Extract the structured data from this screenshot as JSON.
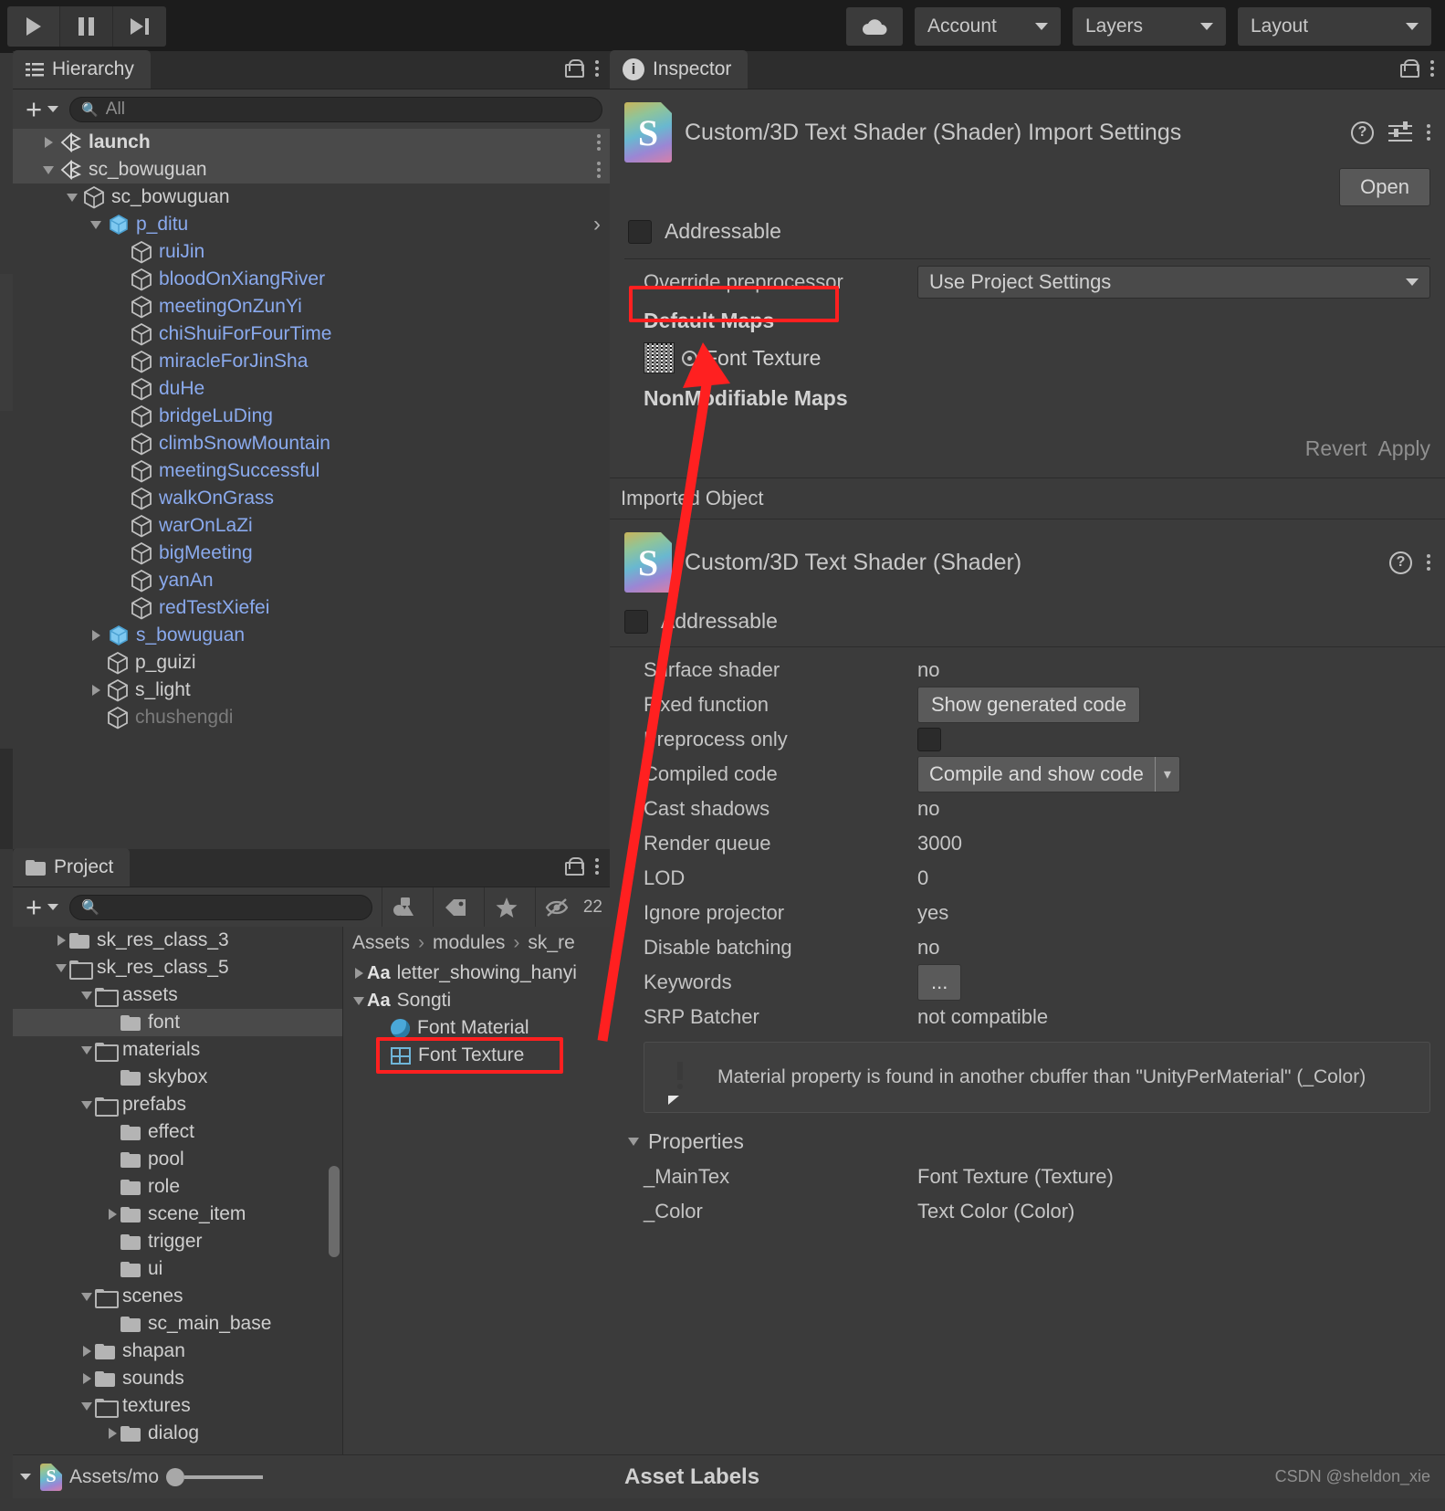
{
  "toolbar": {
    "play_icon": "play-icon",
    "pause_icon": "pause-icon",
    "step_icon": "step-icon",
    "cloud_icon": "cloud-icon",
    "account_label": "Account",
    "layers_label": "Layers",
    "layout_label": "Layout"
  },
  "hierarchy": {
    "tab_label": "Hierarchy",
    "search_placeholder": "All",
    "search_value": "",
    "items": [
      {
        "label": "launch",
        "depth": 1,
        "arrow": "right",
        "icon": "unity-scene-icon",
        "style": "white",
        "selected": true,
        "kebab": true
      },
      {
        "label": "sc_bowuguan",
        "depth": 1,
        "arrow": "down",
        "icon": "unity-scene-icon",
        "style": "plain",
        "selected": true,
        "kebab": true
      },
      {
        "label": "sc_bowuguan",
        "depth": 2,
        "arrow": "down",
        "icon": "cube-icon",
        "style": "plain",
        "selected": false,
        "kebab": false
      },
      {
        "label": "p_ditu",
        "depth": 3,
        "arrow": "down",
        "icon": "prefab-cube-icon",
        "style": "blue",
        "selected": false,
        "kebab": false,
        "chevron": true
      },
      {
        "label": "ruiJin",
        "depth": 4,
        "arrow": "none",
        "icon": "cube-icon",
        "style": "blue",
        "selected": false,
        "kebab": false
      },
      {
        "label": "bloodOnXiangRiver",
        "depth": 4,
        "arrow": "none",
        "icon": "cube-icon",
        "style": "blue",
        "selected": false,
        "kebab": false
      },
      {
        "label": "meetingOnZunYi",
        "depth": 4,
        "arrow": "none",
        "icon": "cube-icon",
        "style": "blue",
        "selected": false,
        "kebab": false
      },
      {
        "label": "chiShuiForFourTime",
        "depth": 4,
        "arrow": "none",
        "icon": "cube-icon",
        "style": "blue",
        "selected": false,
        "kebab": false
      },
      {
        "label": "miracleForJinSha",
        "depth": 4,
        "arrow": "none",
        "icon": "cube-icon",
        "style": "blue",
        "selected": false,
        "kebab": false
      },
      {
        "label": "duHe",
        "depth": 4,
        "arrow": "none",
        "icon": "cube-icon",
        "style": "blue",
        "selected": false,
        "kebab": false
      },
      {
        "label": "bridgeLuDing",
        "depth": 4,
        "arrow": "none",
        "icon": "cube-icon",
        "style": "blue",
        "selected": false,
        "kebab": false
      },
      {
        "label": "climbSnowMountain",
        "depth": 4,
        "arrow": "none",
        "icon": "cube-icon",
        "style": "blue",
        "selected": false,
        "kebab": false
      },
      {
        "label": "meetingSuccessful",
        "depth": 4,
        "arrow": "none",
        "icon": "cube-icon",
        "style": "blue",
        "selected": false,
        "kebab": false
      },
      {
        "label": "walkOnGrass",
        "depth": 4,
        "arrow": "none",
        "icon": "cube-icon",
        "style": "blue",
        "selected": false,
        "kebab": false
      },
      {
        "label": "warOnLaZi",
        "depth": 4,
        "arrow": "none",
        "icon": "cube-icon",
        "style": "blue",
        "selected": false,
        "kebab": false
      },
      {
        "label": "bigMeeting",
        "depth": 4,
        "arrow": "none",
        "icon": "cube-icon",
        "style": "blue",
        "selected": false,
        "kebab": false
      },
      {
        "label": "yanAn",
        "depth": 4,
        "arrow": "none",
        "icon": "cube-icon",
        "style": "blue",
        "selected": false,
        "kebab": false
      },
      {
        "label": "redTestXiefei",
        "depth": 4,
        "arrow": "none",
        "icon": "cube-icon",
        "style": "blue",
        "selected": false,
        "kebab": false
      },
      {
        "label": "s_bowuguan",
        "depth": 3,
        "arrow": "right",
        "icon": "prefab-cube-icon",
        "style": "blue",
        "selected": false,
        "kebab": false
      },
      {
        "label": "p_guizi",
        "depth": 3,
        "arrow": "none",
        "icon": "cube-icon",
        "style": "plain",
        "selected": false,
        "kebab": false
      },
      {
        "label": "s_light",
        "depth": 3,
        "arrow": "right",
        "icon": "cube-icon",
        "style": "plain",
        "selected": false,
        "kebab": false
      },
      {
        "label": "chushengdi",
        "depth": 3,
        "arrow": "none",
        "icon": "cube-icon",
        "style": "dim",
        "selected": false,
        "kebab": false
      }
    ]
  },
  "project": {
    "tab_label": "Project",
    "search_placeholder": "",
    "search_value": "",
    "hidden_count": "22",
    "breadcrumb": [
      "Assets",
      "modules",
      "sk_re"
    ],
    "status_path": "Assets/mo",
    "folders": [
      {
        "label": "sk_res_class_3",
        "depth": 1,
        "arrow": "right",
        "open": false,
        "selected": false
      },
      {
        "label": "sk_res_class_5",
        "depth": 1,
        "arrow": "down",
        "open": true,
        "selected": false
      },
      {
        "label": "assets",
        "depth": 2,
        "arrow": "down",
        "open": true,
        "selected": false
      },
      {
        "label": "font",
        "depth": 3,
        "arrow": "none",
        "open": false,
        "selected": true
      },
      {
        "label": "materials",
        "depth": 2,
        "arrow": "down",
        "open": true,
        "selected": false
      },
      {
        "label": "skybox",
        "depth": 3,
        "arrow": "none",
        "open": false,
        "selected": false
      },
      {
        "label": "prefabs",
        "depth": 2,
        "arrow": "down",
        "open": true,
        "selected": false
      },
      {
        "label": "effect",
        "depth": 3,
        "arrow": "none",
        "open": false,
        "selected": false
      },
      {
        "label": "pool",
        "depth": 3,
        "arrow": "none",
        "open": false,
        "selected": false
      },
      {
        "label": "role",
        "depth": 3,
        "arrow": "none",
        "open": false,
        "selected": false
      },
      {
        "label": "scene_item",
        "depth": 3,
        "arrow": "right",
        "open": false,
        "selected": false
      },
      {
        "label": "trigger",
        "depth": 3,
        "arrow": "none",
        "open": false,
        "selected": false
      },
      {
        "label": "ui",
        "depth": 3,
        "arrow": "none",
        "open": false,
        "selected": false
      },
      {
        "label": "scenes",
        "depth": 2,
        "arrow": "down",
        "open": true,
        "selected": false
      },
      {
        "label": "sc_main_base",
        "depth": 3,
        "arrow": "none",
        "open": false,
        "selected": false
      },
      {
        "label": "shapan",
        "depth": 2,
        "arrow": "right",
        "open": false,
        "selected": false
      },
      {
        "label": "sounds",
        "depth": 2,
        "arrow": "right",
        "open": false,
        "selected": false
      },
      {
        "label": "textures",
        "depth": 2,
        "arrow": "down",
        "open": true,
        "selected": false
      },
      {
        "label": "dialog",
        "depth": 3,
        "arrow": "right",
        "open": false,
        "selected": false
      }
    ],
    "assets": [
      {
        "label": "letter_showing_hanyi",
        "depth": 1,
        "arrow": "right",
        "icon": "font-icon",
        "highlight": false
      },
      {
        "label": "Songti",
        "depth": 1,
        "arrow": "down",
        "icon": "font-icon",
        "highlight": false
      },
      {
        "label": "Font Material",
        "depth": 2,
        "arrow": "none",
        "icon": "material-icon",
        "highlight": false
      },
      {
        "label": "Font Texture",
        "depth": 2,
        "arrow": "none",
        "icon": "texture-icon",
        "highlight": true
      }
    ],
    "filter_icons": [
      "asset-type-filter-icon",
      "label-filter-icon",
      "favorite-filter-icon",
      "hidden-filter-icon"
    ]
  },
  "inspector": {
    "tab_label": "Inspector",
    "title": "Custom/3D Text Shader (Shader) Import Settings",
    "icon_letter": "S",
    "open_label": "Open",
    "addressable_label": "Addressable",
    "addressable_checked": false,
    "override_preprocessor_label": "Override preprocessor",
    "override_preprocessor_value": "Use Project Settings",
    "default_maps_label": "Default Maps",
    "font_texture_label": "Font Texture",
    "nonmodifiable_maps_label": "NonModifiable Maps",
    "revert_label": "Revert",
    "apply_label": "Apply",
    "imported_object_label": "Imported Object",
    "imported_title": "Custom/3D Text Shader (Shader)",
    "imported_addressable_label": "Addressable",
    "shader_props": [
      {
        "label": "Surface shader",
        "value": "no",
        "kind": "text"
      },
      {
        "label": "Fixed function",
        "value": "Show generated code",
        "kind": "button"
      },
      {
        "label": "Preprocess only",
        "value": "",
        "kind": "checkbox"
      },
      {
        "label": "Compiled code",
        "value": "Compile and show code",
        "kind": "split-button"
      },
      {
        "label": "Cast shadows",
        "value": "no",
        "kind": "text"
      },
      {
        "label": "Render queue",
        "value": "3000",
        "kind": "text"
      },
      {
        "label": "LOD",
        "value": "0",
        "kind": "text"
      },
      {
        "label": "Ignore projector",
        "value": "yes",
        "kind": "text"
      },
      {
        "label": "Disable batching",
        "value": "no",
        "kind": "text"
      },
      {
        "label": "Keywords",
        "value": "...",
        "kind": "button"
      },
      {
        "label": "SRP Batcher",
        "value": "not compatible",
        "kind": "text"
      }
    ],
    "warning_text": "Material property is found in another cbuffer than \"UnityPerMaterial\" (_Color)",
    "properties_label": "Properties",
    "properties": [
      {
        "label": "_MainTex",
        "value": "Font Texture (Texture)"
      },
      {
        "label": "_Color",
        "value": "Text Color (Color)"
      }
    ],
    "asset_labels_label": "Asset Labels"
  },
  "watermark": "CSDN @sheldon_xie",
  "colors": {
    "annotation_red": "#ff2020",
    "hierarchy_blue": "#8aaaee",
    "panel_bg": "#383838",
    "inspector_bg": "#3b3b3b"
  }
}
